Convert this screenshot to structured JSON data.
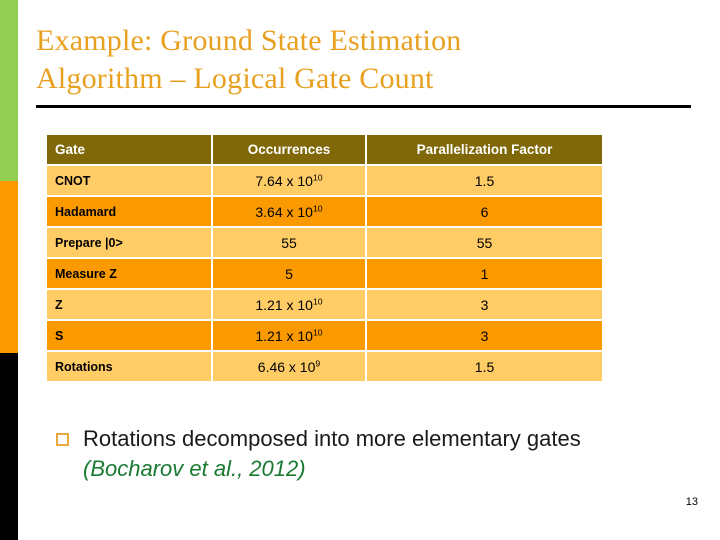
{
  "slide": {
    "title": "Example: Ground State Estimation\nAlgorithm – Logical Gate Count",
    "page_number": "13"
  },
  "colors": {
    "title_orange": "#e8a020",
    "header_olive": "#806808",
    "row_light": "#ffcc66",
    "row_dark": "#fb9a00",
    "stripe_green": "#91ce52",
    "stripe_orange": "#fb9a00",
    "stripe_black": "#000000",
    "citation_green": "#1a7a32",
    "bullet_gold": "#e8a83c"
  },
  "table": {
    "headers": {
      "gate": "Gate",
      "occurrences": "Occurrences",
      "parallelization": "Parallelization Factor"
    },
    "rows": [
      {
        "gate": "CNOT",
        "occ_mantissa": "7.64 x 10",
        "occ_exp": "10",
        "occ_plain": "",
        "par": "1.5"
      },
      {
        "gate": "Hadamard",
        "occ_mantissa": "3.64 x 10",
        "occ_exp": "10",
        "occ_plain": "",
        "par": "6"
      },
      {
        "gate": "Prepare |0>",
        "occ_mantissa": "",
        "occ_exp": "",
        "occ_plain": "55",
        "par": "55"
      },
      {
        "gate": "Measure Z",
        "occ_mantissa": "",
        "occ_exp": "",
        "occ_plain": "5",
        "par": "1"
      },
      {
        "gate": "Z",
        "occ_mantissa": "1.21 x 10",
        "occ_exp": "10",
        "occ_plain": "",
        "par": "3"
      },
      {
        "gate": "S",
        "occ_mantissa": "1.21 x 10",
        "occ_exp": "10",
        "occ_plain": "",
        "par": "3"
      },
      {
        "gate": "Rotations",
        "occ_mantissa": "6.46 x 10",
        "occ_exp": "9",
        "occ_plain": "",
        "par": "1.5"
      }
    ]
  },
  "bullet": {
    "icon": "square-bullet-icon",
    "text_main": "Rotations decomposed into more elementary gates ",
    "citation": "(Bocharov et al., 2012)"
  }
}
